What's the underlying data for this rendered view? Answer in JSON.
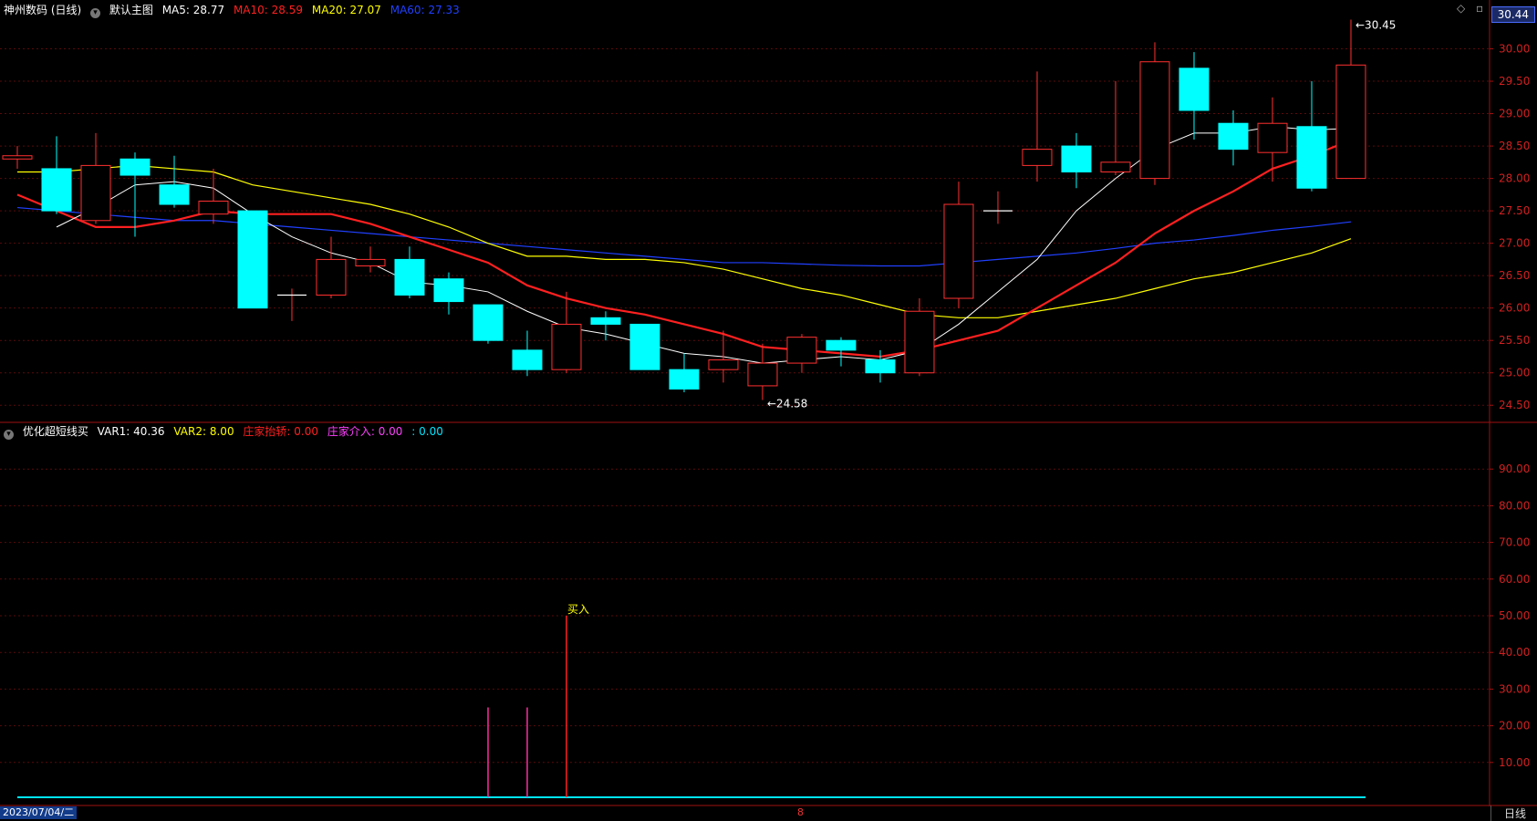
{
  "header": {
    "stock": "神州数码 (日线)",
    "template": "默认主图",
    "ma5": {
      "label": "MA5:",
      "value": "28.77",
      "color": "#ffffff"
    },
    "ma10": {
      "label": "MA10:",
      "value": "28.59",
      "color": "#ff2020"
    },
    "ma20": {
      "label": "MA20:",
      "value": "27.07",
      "color": "#ffff00"
    },
    "ma60": {
      "label": "MA60:",
      "value": "27.33",
      "color": "#2040ff"
    }
  },
  "last_price": "30.44",
  "indicator_header": {
    "name": "优化超短线买",
    "var1": {
      "label": "VAR1:",
      "value": "40.36",
      "color": "#ffffff"
    },
    "var2": {
      "label": "VAR2:",
      "value": "8.00",
      "color": "#ffff00"
    },
    "zj_lp": {
      "label": "庄家抬轿:",
      "value": "0.00",
      "color": "#ff2020"
    },
    "zj_jr": {
      "label": "庄家介入:",
      "value": "0.00",
      "color": "#ff40ff"
    },
    "blank": {
      "label": ":",
      "value": "0.00",
      "color": "#00e5ff"
    }
  },
  "footer": {
    "date": "2023/07/04/二",
    "cursor_label": "8",
    "period_tab": "日线"
  },
  "chart_data": [
    {
      "type": "candlestick",
      "ylim": [
        24.25,
        30.5
      ],
      "yticks": [
        "30.00",
        "29.50",
        "29.00",
        "28.50",
        "28.00",
        "27.50",
        "27.00",
        "26.50",
        "26.00",
        "25.50",
        "25.00",
        "24.50"
      ],
      "candles": [
        {
          "o": 28.3,
          "h": 28.5,
          "l": 28.15,
          "c": 28.35
        },
        {
          "o": 28.15,
          "h": 28.65,
          "l": 27.45,
          "c": 27.5
        },
        {
          "o": 27.35,
          "h": 28.7,
          "l": 27.3,
          "c": 28.2
        },
        {
          "o": 28.3,
          "h": 28.4,
          "l": 27.1,
          "c": 28.05
        },
        {
          "o": 27.9,
          "h": 28.35,
          "l": 27.55,
          "c": 27.6
        },
        {
          "o": 27.45,
          "h": 28.15,
          "l": 27.3,
          "c": 27.65
        },
        {
          "o": 27.5,
          "h": 27.5,
          "l": 26.0,
          "c": 26.0
        },
        {
          "o": 26.2,
          "h": 26.3,
          "l": 25.8,
          "c": 26.2
        },
        {
          "o": 26.2,
          "h": 27.1,
          "l": 26.15,
          "c": 26.75
        },
        {
          "o": 26.65,
          "h": 26.95,
          "l": 26.55,
          "c": 26.75
        },
        {
          "o": 26.75,
          "h": 26.95,
          "l": 26.15,
          "c": 26.2
        },
        {
          "o": 26.45,
          "h": 26.55,
          "l": 25.9,
          "c": 26.1
        },
        {
          "o": 26.05,
          "h": 26.05,
          "l": 25.45,
          "c": 25.5
        },
        {
          "o": 25.35,
          "h": 25.65,
          "l": 24.95,
          "c": 25.05
        },
        {
          "o": 25.05,
          "h": 26.25,
          "l": 25.0,
          "c": 25.75
        },
        {
          "o": 25.85,
          "h": 25.95,
          "l": 25.5,
          "c": 25.75
        },
        {
          "o": 25.75,
          "h": 25.75,
          "l": 25.05,
          "c": 25.05
        },
        {
          "o": 25.05,
          "h": 25.3,
          "l": 24.7,
          "c": 24.75
        },
        {
          "o": 25.05,
          "h": 25.65,
          "l": 24.85,
          "c": 25.2
        },
        {
          "o": 24.8,
          "h": 25.45,
          "l": 24.58,
          "c": 25.15
        },
        {
          "o": 25.15,
          "h": 25.6,
          "l": 25.0,
          "c": 25.55
        },
        {
          "o": 25.5,
          "h": 25.55,
          "l": 25.1,
          "c": 25.35
        },
        {
          "o": 25.2,
          "h": 25.35,
          "l": 24.85,
          "c": 25.0
        },
        {
          "o": 25.0,
          "h": 26.15,
          "l": 24.95,
          "c": 25.95
        },
        {
          "o": 26.15,
          "h": 27.95,
          "l": 26.0,
          "c": 27.6
        },
        {
          "o": 27.5,
          "h": 27.8,
          "l": 27.3,
          "c": 27.5
        },
        {
          "o": 28.2,
          "h": 29.65,
          "l": 27.95,
          "c": 28.45
        },
        {
          "o": 28.5,
          "h": 28.7,
          "l": 27.85,
          "c": 28.1
        },
        {
          "o": 28.1,
          "h": 29.5,
          "l": 28.05,
          "c": 28.25
        },
        {
          "o": 28.0,
          "h": 30.1,
          "l": 27.9,
          "c": 29.8
        },
        {
          "o": 29.7,
          "h": 29.95,
          "l": 28.6,
          "c": 29.05
        },
        {
          "o": 28.85,
          "h": 29.05,
          "l": 28.2,
          "c": 28.45
        },
        {
          "o": 28.4,
          "h": 29.25,
          "l": 27.95,
          "c": 28.85
        },
        {
          "o": 28.8,
          "h": 29.5,
          "l": 27.8,
          "c": 27.85
        },
        {
          "o": 28.0,
          "h": 30.45,
          "l": 28.0,
          "c": 29.75
        }
      ],
      "ma5": [
        null,
        27.25,
        27.55,
        27.9,
        27.95,
        27.85,
        27.45,
        27.1,
        26.85,
        26.7,
        26.4,
        26.35,
        26.25,
        25.95,
        25.7,
        25.6,
        25.45,
        25.3,
        25.25,
        25.15,
        25.2,
        25.25,
        25.2,
        25.35,
        25.75,
        26.25,
        26.75,
        27.5,
        28.0,
        28.45,
        28.7,
        28.7,
        28.8,
        28.75,
        28.77
      ],
      "ma10": [
        27.75,
        27.5,
        27.25,
        27.25,
        27.35,
        27.5,
        27.45,
        27.45,
        27.45,
        27.3,
        27.1,
        26.9,
        26.7,
        26.35,
        26.15,
        26.0,
        25.9,
        25.75,
        25.6,
        25.4,
        25.35,
        25.3,
        25.25,
        25.35,
        25.5,
        25.65,
        26.0,
        26.35,
        26.7,
        27.15,
        27.5,
        27.8,
        28.15,
        28.35,
        28.59
      ],
      "ma20": [
        28.1,
        28.1,
        28.15,
        28.2,
        28.15,
        28.1,
        27.9,
        27.8,
        27.7,
        27.6,
        27.45,
        27.25,
        27.0,
        26.8,
        26.8,
        26.75,
        26.75,
        26.7,
        26.6,
        26.45,
        26.3,
        26.2,
        26.05,
        25.9,
        25.85,
        25.85,
        25.95,
        26.05,
        26.15,
        26.3,
        26.45,
        26.55,
        26.7,
        26.85,
        27.07
      ],
      "ma60": [
        27.55,
        27.5,
        27.45,
        27.4,
        27.35,
        27.35,
        27.3,
        27.25,
        27.2,
        27.15,
        27.1,
        27.05,
        27.0,
        26.95,
        26.9,
        26.85,
        26.8,
        26.75,
        26.7,
        26.7,
        26.68,
        26.66,
        26.65,
        26.65,
        26.7,
        26.75,
        26.8,
        26.85,
        26.92,
        27.0,
        27.05,
        27.12,
        27.2,
        27.26,
        27.33
      ],
      "annotations": [
        {
          "index": 34,
          "text": "30.45",
          "kind": "high"
        },
        {
          "index": 19,
          "text": "24.58",
          "kind": "low"
        }
      ]
    },
    {
      "type": "bar",
      "ylim": [
        0,
        100
      ],
      "yticks": [
        "90.00",
        "80.00",
        "70.00",
        "60.00",
        "50.00",
        "40.00",
        "30.00",
        "20.00",
        "10.00"
      ],
      "spikes": [
        {
          "index": 12,
          "value": 25,
          "color": "#ff2aa0"
        },
        {
          "index": 13,
          "value": 25,
          "color": "#ff2aa0"
        },
        {
          "index": 14,
          "value": 50,
          "color": "#ff2020"
        }
      ],
      "baseline": {
        "value": 0.5,
        "color": "#00e5ff"
      },
      "signal_label": {
        "index": 14,
        "text": "买入",
        "value": 50
      }
    }
  ]
}
